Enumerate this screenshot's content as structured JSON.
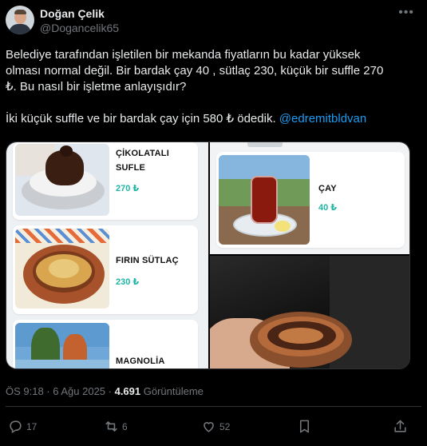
{
  "author": {
    "name": "Doğan Çelik",
    "handle": "@Dogancelik65"
  },
  "tweet": {
    "line1": "Belediye tarafından işletilen bir mekanda fiyatların bu kadar yüksek",
    "line2": "olması normal değil. Bir bardak çay 40 , sütlaç 230, küçük bir suffle 270",
    "line3": "₺. Bu nasıl bir işletme anlayışıdır?",
    "line4": "İki küçük suffle ve bir bardak çay için 580  ₺ ödedik. ",
    "mention": "@edremitbldvan"
  },
  "menu": {
    "items": [
      {
        "title_1": "ÇİKOLATALI",
        "title_2": "SUFLE",
        "price": "270 ₺"
      },
      {
        "title_1": "FIRIN SÜTLAÇ",
        "price": "230 ₺"
      },
      {
        "title_1": "MAGNOLİA"
      },
      {
        "title_1": "ÇAY",
        "price": "40 ₺"
      }
    ]
  },
  "meta": {
    "time_date": "ÖS 9:18 · 6 Ağu 2025 · ",
    "views_count": "4.691",
    "views_label": " Görüntüleme"
  },
  "actions": {
    "replies": "17",
    "retweets": "6",
    "likes": "52"
  },
  "colors": {
    "background": "#000000",
    "text": "#e7e9ea",
    "muted": "#71767b",
    "link": "#1d9bf0",
    "price": "#1fb5a5"
  }
}
